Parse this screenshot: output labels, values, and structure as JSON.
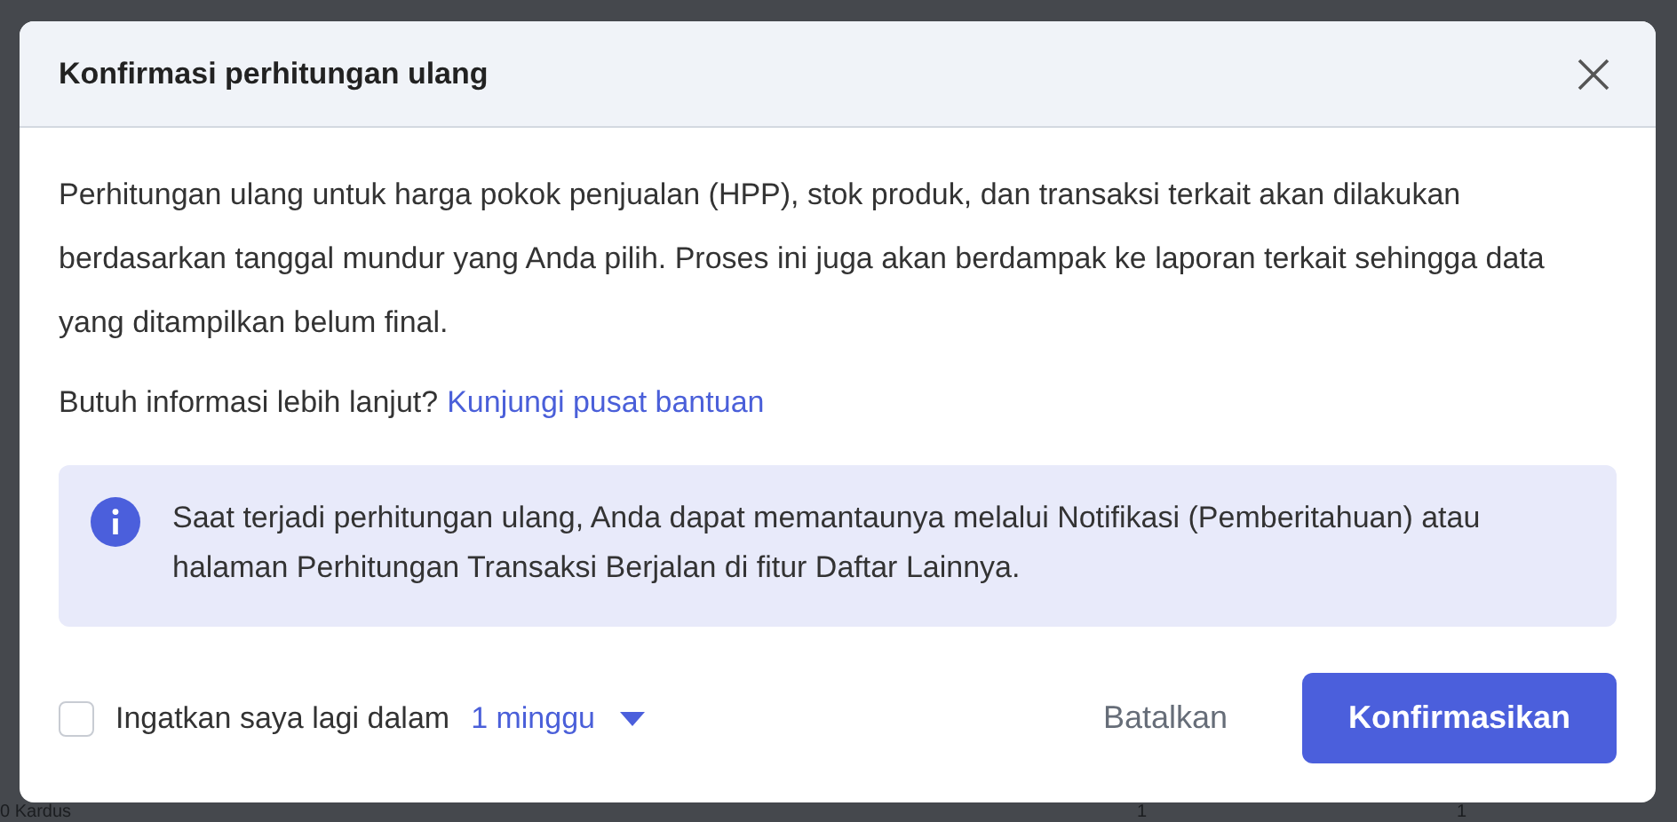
{
  "backdrop": {
    "row_cells": [
      "0 Kardus",
      "1",
      "1"
    ]
  },
  "dialog": {
    "title": "Konfirmasi perhitungan ulang",
    "paragraph": "Perhitungan ulang untuk harga pokok penjualan (HPP), stok produk, dan transaksi terkait akan dilakukan berdasarkan tanggal mundur yang Anda pilih. Proses ini juga akan berdampak ke laporan terkait sehingga data yang ditampilkan belum final.",
    "help_text": "Butuh informasi lebih lanjut?",
    "help_link": "Kunjungi pusat bantuan",
    "info": "Saat terjadi perhitungan ulang, Anda dapat memantaunya melalui Notifikasi (Pemberitahuan) atau halaman Perhitungan Transaksi Berjalan di fitur Daftar Lainnya.",
    "reminder": {
      "checked": false,
      "label": "Ingatkan saya lagi dalam",
      "value": "1 minggu"
    },
    "buttons": [
      {
        "label": "Batalkan",
        "kind": "secondary"
      },
      {
        "label": "Konfirmasikan",
        "kind": "primary"
      }
    ]
  }
}
